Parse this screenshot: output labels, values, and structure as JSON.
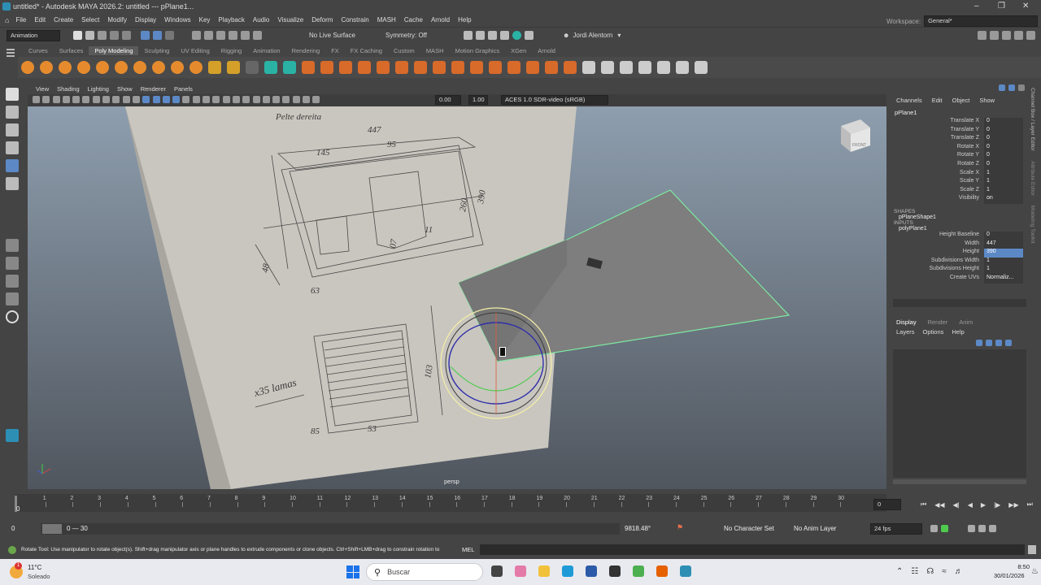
{
  "title": "untitled* - Autodesk MAYA 2026.2: untitled   ---   pPlane1...",
  "workspace_label": "Workspace:",
  "workspace_value": "General*",
  "menus": [
    "File",
    "Edit",
    "Create",
    "Select",
    "Modify",
    "Display",
    "Windows",
    "Key",
    "Playback",
    "Audio",
    "Visualize",
    "Deform",
    "Constrain",
    "MASH",
    "Cache",
    "Arnold",
    "Help"
  ],
  "status": {
    "menuset": "Animation",
    "live_surface": "No Live Surface",
    "symmetry": "Symmetry: Off",
    "user": "Jordi Alentorn"
  },
  "shelf_tabs": [
    "Curves",
    "Surfaces",
    "Poly Modeling",
    "Sculpting",
    "UV Editing",
    "Rigging",
    "Animation",
    "Rendering",
    "FX",
    "FX Caching",
    "Custom",
    "MASH",
    "Motion Graphics",
    "XGen",
    "Arnold"
  ],
  "shelf_active": "Poly Modeling",
  "viewport": {
    "menus": [
      "View",
      "Shading",
      "Lighting",
      "Show",
      "Renderer",
      "Panels"
    ],
    "field1": "0.00",
    "field2": "1.00",
    "colorspace": "ACES 1.0 SDR-video (sRGB)",
    "camera": "persp",
    "cube_label": "FRONT",
    "sketch": {
      "top": "Pelte dereita",
      "w447": "447",
      "w145": "145",
      "w95": "95",
      "h260": "260",
      "h390": "390",
      "h11": "11",
      "h48": "48",
      "h63": "63",
      "h07": "07",
      "bottom": "x35 lamas",
      "b85": "85",
      "b53": "53",
      "b103": "103"
    }
  },
  "channel_box": {
    "tabs": [
      "Channels",
      "Edit",
      "Object",
      "Show"
    ],
    "object": "pPlane1",
    "transforms": [
      {
        "label": "Translate X",
        "value": "0"
      },
      {
        "label": "Translate Y",
        "value": "0"
      },
      {
        "label": "Translate Z",
        "value": "0"
      },
      {
        "label": "Rotate X",
        "value": "0"
      },
      {
        "label": "Rotate Y",
        "value": "0"
      },
      {
        "label": "Rotate Z",
        "value": "0"
      },
      {
        "label": "Scale X",
        "value": "1"
      },
      {
        "label": "Scale Y",
        "value": "1"
      },
      {
        "label": "Scale Z",
        "value": "1"
      },
      {
        "label": "Visibility",
        "value": "on"
      }
    ],
    "shapes_header": "SHAPES",
    "shape_name": "pPlaneShape1",
    "inputs_header": "INPUTS",
    "input_name": "polyPlane1",
    "inputs": [
      {
        "label": "Height Baseline",
        "value": "0"
      },
      {
        "label": "Width",
        "value": "447"
      },
      {
        "label": "Height",
        "value": "390",
        "selected": true
      },
      {
        "label": "Subdivisions Width",
        "value": "1"
      },
      {
        "label": "Subdivisions Height",
        "value": "1"
      },
      {
        "label": "Create UVs",
        "value": "Normaliz..."
      }
    ],
    "side_tabs": [
      "Channel Box / Layer Editor",
      "Attribute Editor",
      "Modeling Toolkit"
    ]
  },
  "layer_editor": {
    "tabs": [
      "Display",
      "Render",
      "Anim"
    ],
    "menus": [
      "Layers",
      "Options",
      "Help"
    ]
  },
  "timeline": {
    "ticks": [
      "1",
      "2",
      "3",
      "4",
      "5",
      "6",
      "7",
      "8",
      "9",
      "10",
      "11",
      "12",
      "13",
      "14",
      "15",
      "16",
      "17",
      "18",
      "19",
      "20",
      "21",
      "22",
      "23",
      "24",
      "25",
      "26",
      "27",
      "28",
      "29",
      "30"
    ],
    "current_start": "0",
    "current": "0",
    "range_start": "0",
    "range_field": "0",
    "range_label": "0 — 30",
    "angle": "9818.48°",
    "char_set": "No Character Set",
    "anim_layer": "No Anim Layer",
    "fps": "24 fps"
  },
  "help_line": "Rotate Tool: Use manipulator to rotate object(s). Shift+drag manipulator axis or plane handles to extrude components or clone objects. Ctrl+Shift+LMB+drag to constrain rotation to",
  "mel_label": "MEL",
  "taskbar": {
    "temp": "11°C",
    "weather": "Soleado",
    "search": "Buscar",
    "time": "8:50",
    "date": "30/01/2026",
    "badge": "1"
  },
  "colors": {
    "selection_green": "#7de8a0",
    "ui_bg": "#444444",
    "viewport_top": "#8e9eae",
    "viewport_bottom": "#50565e",
    "highlight": "#5c89c6"
  }
}
